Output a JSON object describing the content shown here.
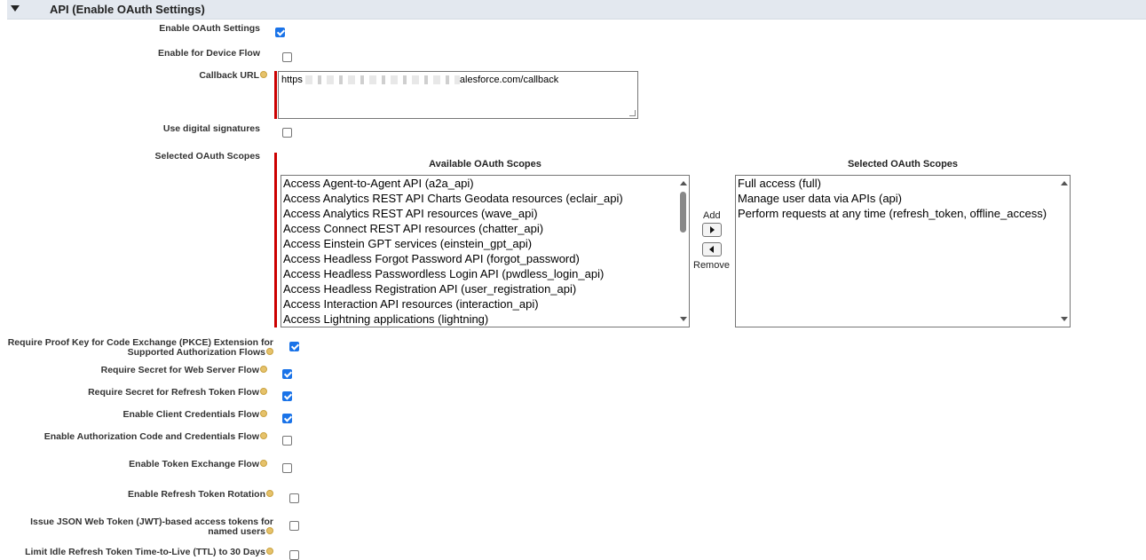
{
  "section": {
    "title": "API (Enable OAuth Settings)"
  },
  "fields": {
    "enable_oauth": {
      "label": "Enable OAuth Settings",
      "checked": true
    },
    "device_flow": {
      "label": "Enable for Device Flow",
      "checked": false
    },
    "callback_url": {
      "label": "Callback URL",
      "value_prefix": "https",
      "value_suffix": "alesforce.com/callback"
    },
    "digital_signatures": {
      "label": "Use digital signatures",
      "checked": false
    },
    "selected_scopes": {
      "label": "Selected OAuth Scopes"
    },
    "pkce": {
      "label": "Require Proof Key for Code Exchange (PKCE) Extension for Supported Authorization Flows",
      "checked": true
    },
    "secret_web_server": {
      "label": "Require Secret for Web Server Flow",
      "checked": true
    },
    "secret_refresh": {
      "label": "Require Secret for Refresh Token Flow",
      "checked": true
    },
    "client_credentials": {
      "label": "Enable Client Credentials Flow",
      "checked": true
    },
    "auth_code_credentials": {
      "label": "Enable Authorization Code and Credentials Flow",
      "checked": false
    },
    "token_exchange": {
      "label": "Enable Token Exchange Flow",
      "checked": false
    },
    "refresh_rotation": {
      "label": "Enable Refresh Token Rotation",
      "checked": false
    },
    "jwt_tokens": {
      "label": "Issue JSON Web Token (JWT)-based access tokens for named users",
      "checked": false
    },
    "idle_ttl": {
      "label": "Limit Idle Refresh Token Time-to-Live (TTL) to 30 Days",
      "checked": false
    }
  },
  "scopes": {
    "available_title": "Available OAuth Scopes",
    "selected_title": "Selected OAuth Scopes",
    "available": [
      "Access Agent-to-Agent API (a2a_api)",
      "Access Analytics REST API Charts Geodata resources (eclair_api)",
      "Access Analytics REST API resources (wave_api)",
      "Access Connect REST API resources (chatter_api)",
      "Access Einstein GPT services (einstein_gpt_api)",
      "Access Headless Forgot Password API (forgot_password)",
      "Access Headless Passwordless Login API (pwdless_login_api)",
      "Access Headless Registration API (user_registration_api)",
      "Access Interaction API resources (interaction_api)",
      "Access Lightning applications (lightning)"
    ],
    "selected": [
      "Full access (full)",
      "Manage user data via APIs (api)",
      "Perform requests at any time (refresh_token, offline_access)"
    ],
    "add_label": "Add",
    "remove_label": "Remove"
  }
}
